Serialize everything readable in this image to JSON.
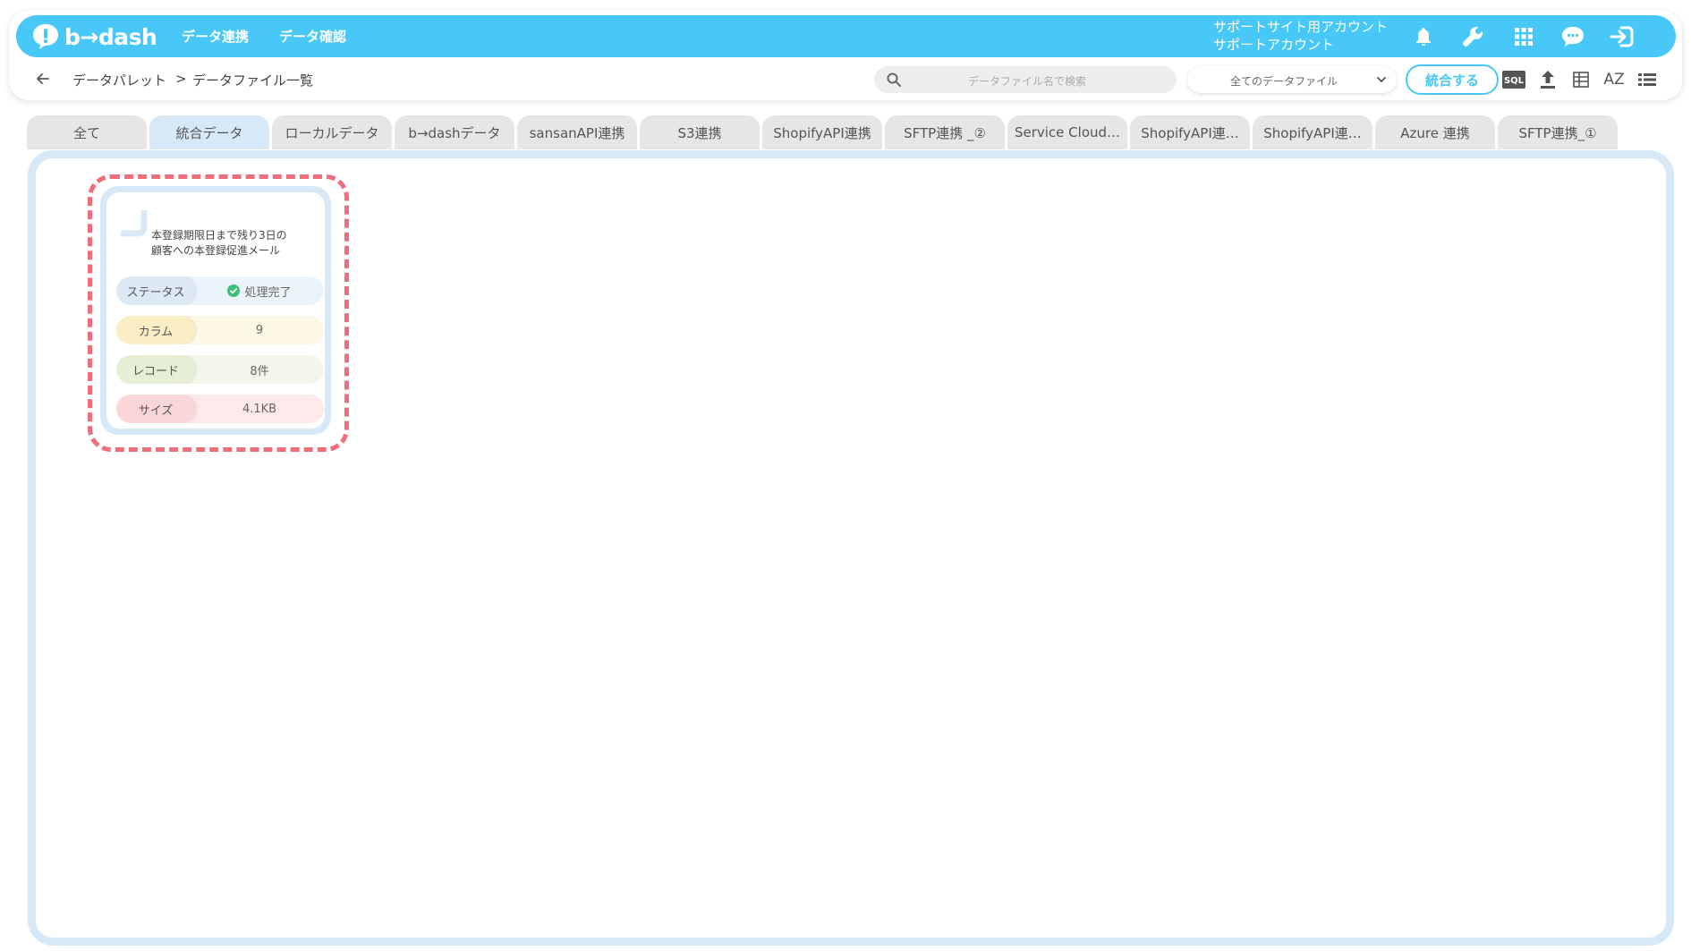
{
  "app": {
    "logo_text": "b→dash",
    "nav": [
      "データ連携",
      "データ確認"
    ],
    "account_line1": "サポートサイト用アカウント",
    "account_line2": "サポートアカウント"
  },
  "breadcrumb": {
    "root": "データパレット",
    "separator": ">",
    "current": "データファイル一覧"
  },
  "search": {
    "placeholder": "データファイル名で検索"
  },
  "filter": {
    "selected": "全てのデータファイル"
  },
  "toolbar": {
    "merge_label": "統合する",
    "sql_label": "SQL",
    "sort_label": "AZ"
  },
  "tabs": [
    {
      "label": "全て"
    },
    {
      "label": "統合データ",
      "active": true
    },
    {
      "label": "ローカルデータ"
    },
    {
      "label": "b→dashデータ"
    },
    {
      "label": "sansanAPI連携"
    },
    {
      "label": "S3連携"
    },
    {
      "label": "ShopifyAPI連携"
    },
    {
      "label": "SFTP連携 _②"
    },
    {
      "label": "Service Cloud…"
    },
    {
      "label": "ShopifyAPI連…"
    },
    {
      "label": "ShopifyAPI連…"
    },
    {
      "label": "Azure 連携"
    },
    {
      "label": "SFTP連携_①"
    }
  ],
  "card": {
    "title_line1": "本登録期限日まで残り3日の",
    "title_line2": "顧客への本登録促進メール",
    "status_label": "ステータス",
    "status_value": "処理完了",
    "column_label": "カラム",
    "column_value": "9",
    "record_label": "レコード",
    "record_value": "8件",
    "size_label": "サイズ",
    "size_value": "4.1KB"
  },
  "colors": {
    "header": "#48c8f8",
    "highlight": "#f06e7b",
    "status_ok": "#3dbf7a"
  }
}
